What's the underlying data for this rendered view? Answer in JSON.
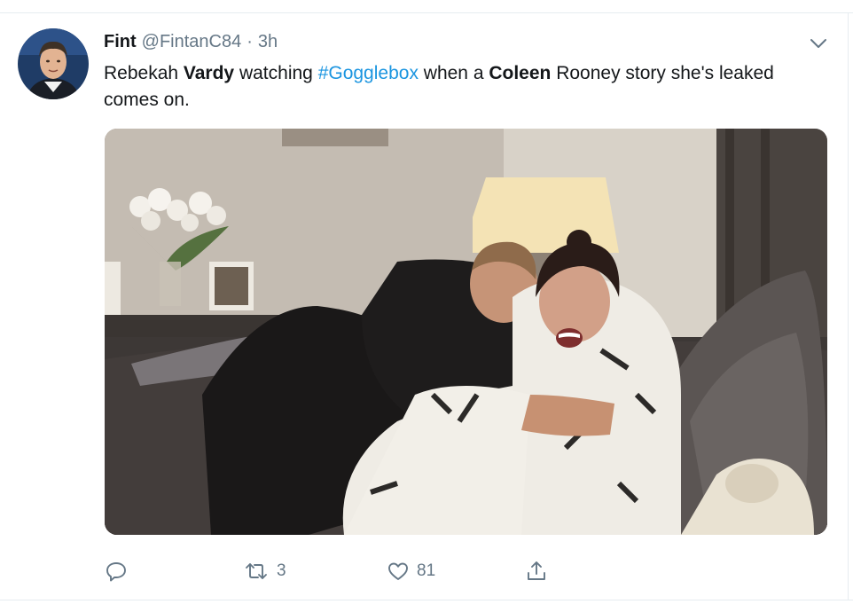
{
  "tweet": {
    "author_name": "Fint",
    "handle": "@FintanC84",
    "separator": "·",
    "time": "3h",
    "text": {
      "part1": "Rebekah ",
      "bold1": "Vardy",
      "part2": " watching ",
      "hashtag": "#Gogglebox",
      "part3": " when a ",
      "bold2": "Coleen",
      "part4": " Rooney story she's leaked comes on."
    },
    "actions": {
      "reply_icon": "reply-icon",
      "retweet_icon": "retweet-icon",
      "retweet_count": "3",
      "like_icon": "heart-icon",
      "like_count": "81",
      "share_icon": "share-icon"
    }
  },
  "colors": {
    "hashtag": "#1b95e0",
    "muted": "#657786",
    "text": "#14171a",
    "border": "#e6ecf0"
  }
}
